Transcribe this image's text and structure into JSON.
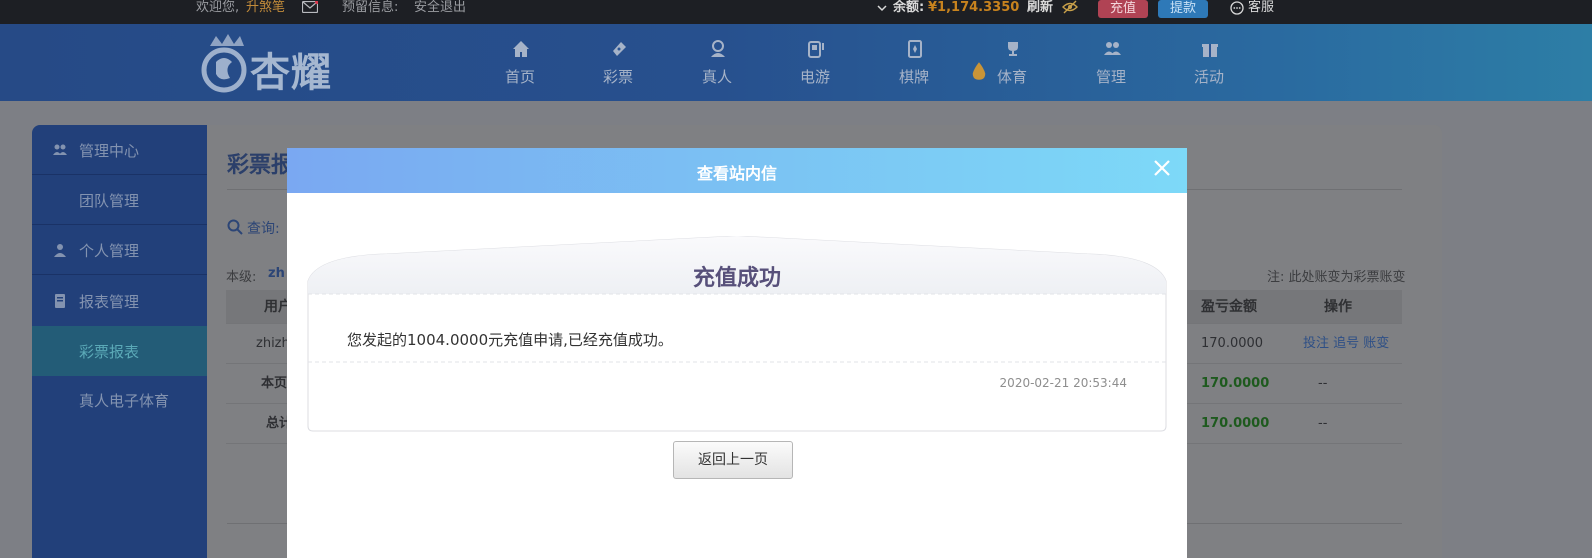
{
  "topbar": {
    "welcome": "欢迎您,",
    "username": "升煞笔",
    "reserve_label": "预留信息:",
    "logout": "安全退出",
    "balance_label": "余额:",
    "balance": "¥1,174.3350",
    "refresh": "刷新",
    "recharge": "充值",
    "withdraw": "提款",
    "service": "客服"
  },
  "header": {
    "logo_text": "杏耀",
    "nav": [
      {
        "label": "首页",
        "icon": "home-icon"
      },
      {
        "label": "彩票",
        "icon": "ticket-icon"
      },
      {
        "label": "真人",
        "icon": "dealer-icon"
      },
      {
        "label": "电游",
        "icon": "slot-machine-icon"
      },
      {
        "label": "棋牌",
        "icon": "cards-icon"
      },
      {
        "label": "体育",
        "icon": "trophy-icon"
      },
      {
        "label": "管理",
        "icon": "users-icon"
      },
      {
        "label": "活动",
        "icon": "gift-icon"
      }
    ]
  },
  "sidebar": {
    "items": [
      {
        "label": "管理中心",
        "icon": "users-icon"
      },
      {
        "label": "团队管理"
      },
      {
        "label": "个人管理",
        "icon": "user-icon"
      },
      {
        "label": "报表管理",
        "icon": "report-icon"
      },
      {
        "label": "彩票报表"
      },
      {
        "label": "真人电子体育"
      }
    ]
  },
  "content": {
    "title": "彩票报",
    "search_label": "查询:",
    "level_label": "本级:",
    "level_user": "zh",
    "note": "注: 此处账变为彩票账变",
    "headers": [
      "用户",
      "盈亏金额",
      "操作"
    ],
    "rows": [
      {
        "user": "zhizh",
        "amount": "170.0000",
        "ops": "投注 追号 账变"
      },
      {
        "user": "本页",
        "amount": "170.0000",
        "ops": "--"
      },
      {
        "user": "总计",
        "amount": "170.0000",
        "ops": "--"
      }
    ]
  },
  "modal": {
    "title": "查看站内信",
    "heading": "充值成功",
    "message": "您发起的1004.0000元充值申请,已经充值成功。",
    "time": "2020-02-21 20:53:44",
    "back_button": "返回上一页"
  }
}
